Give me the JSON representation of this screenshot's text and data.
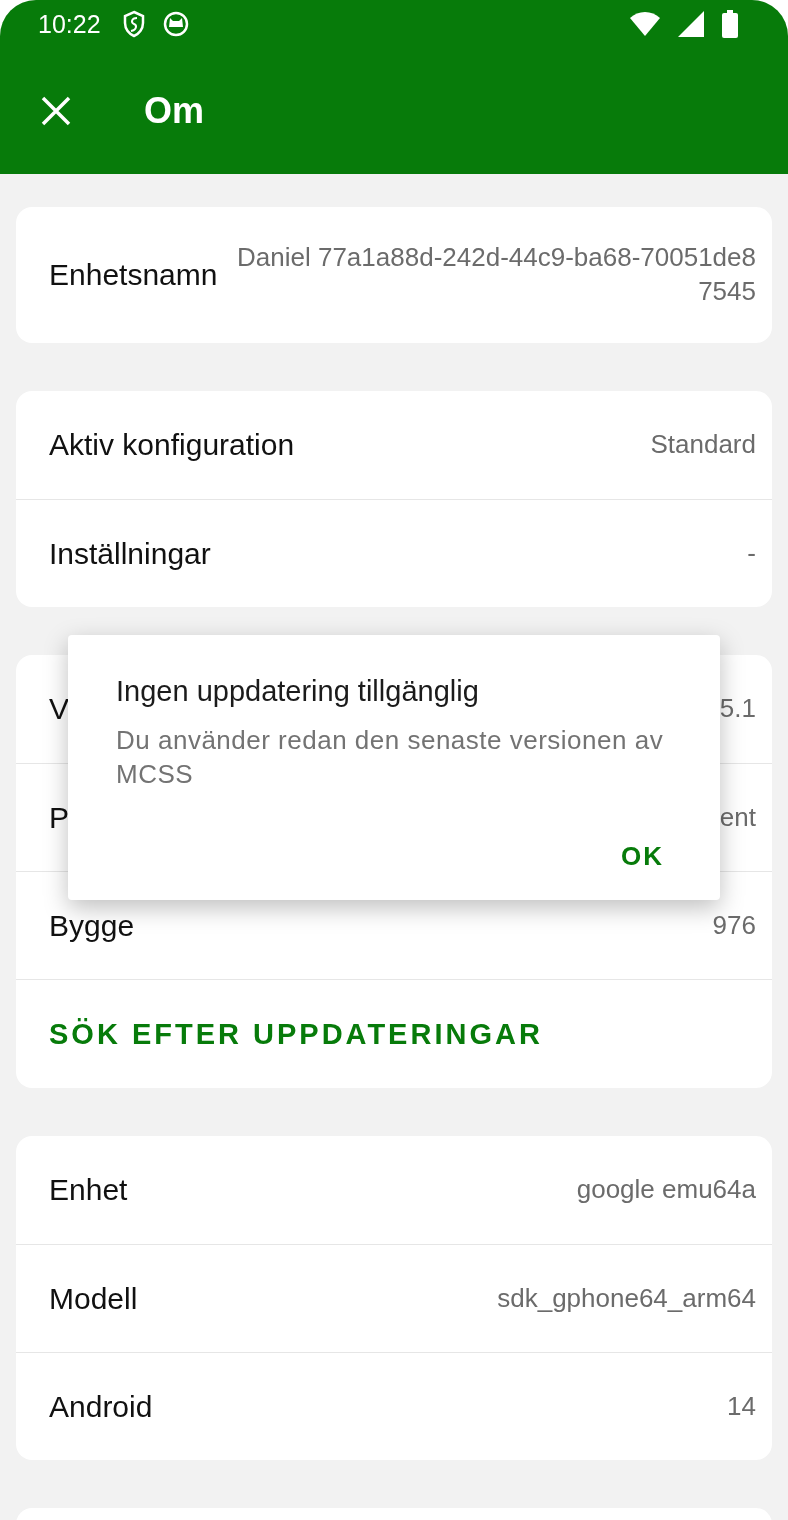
{
  "status_bar": {
    "time": "10:22"
  },
  "toolbar": {
    "title": "Om"
  },
  "sections": [
    {
      "rows": [
        {
          "label": "Enhetsnamn",
          "value": "Daniel 77a1a88d-242d-44c9-ba68-70051de87545"
        }
      ]
    },
    {
      "rows": [
        {
          "label": "Aktiv konfiguration",
          "value": "Standard"
        },
        {
          "label": "Inställningar",
          "value": "-"
        }
      ]
    },
    {
      "rows": [
        {
          "label": "V",
          "value": "5.1"
        },
        {
          "label": "P",
          "value": "ent"
        },
        {
          "label": "Bygge",
          "value": "976"
        }
      ],
      "action": "SÖK EFTER UPPDATERINGAR"
    },
    {
      "rows": [
        {
          "label": "Enhet",
          "value": "google emu64a"
        },
        {
          "label": "Modell",
          "value": "sdk_gphone64_arm64"
        },
        {
          "label": "Android",
          "value": "14"
        }
      ]
    }
  ],
  "dialog": {
    "title": "Ingen uppdatering tillgänglig",
    "message": "Du använder redan den senaste versionen av MCSS",
    "button": "OK"
  }
}
